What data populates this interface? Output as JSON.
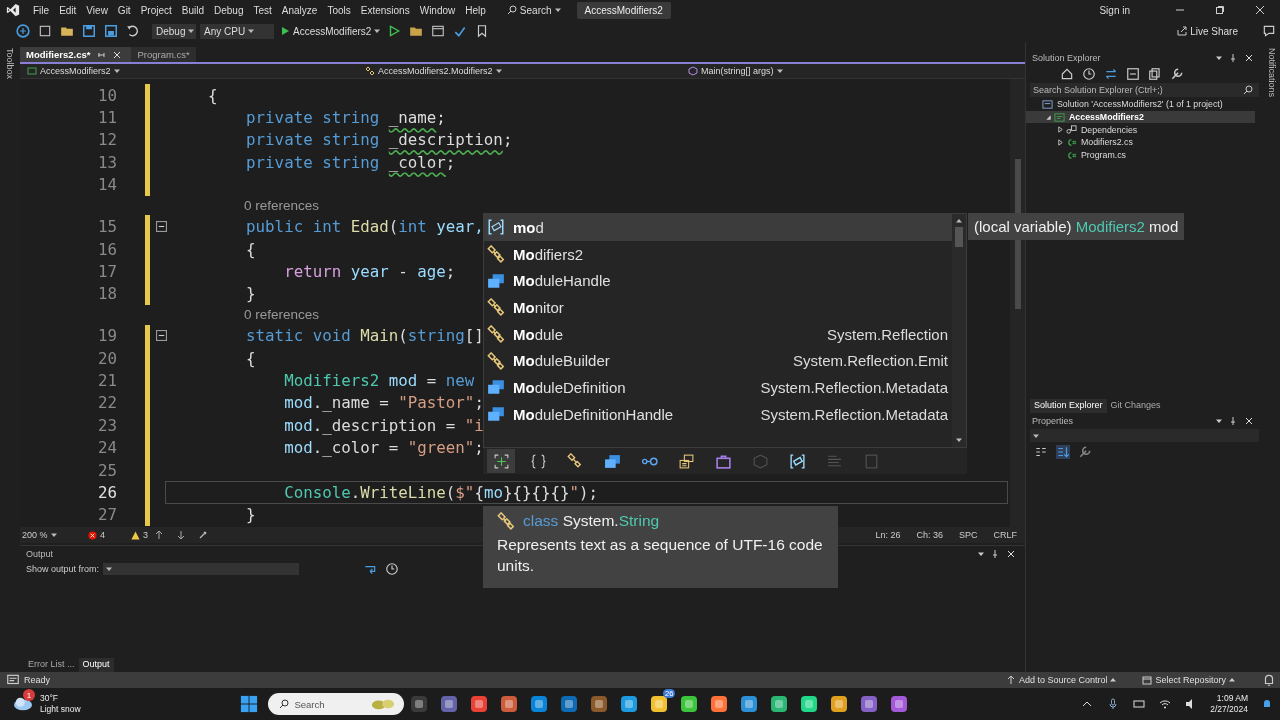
{
  "menu": [
    "File",
    "Edit",
    "View",
    "Git",
    "Project",
    "Build",
    "Debug",
    "Test",
    "Analyze",
    "Tools",
    "Extensions",
    "Window",
    "Help"
  ],
  "search": "Search",
  "solution_title": "AccessModifiers2",
  "sign_in": "Sign in",
  "toolbar": {
    "configuration": "Debug",
    "platform": "Any CPU",
    "run": "AccessModifiers2",
    "live_share": "Live Share"
  },
  "toolbox_label": "Toolbox",
  "notifications_label": "Notifications",
  "editor": {
    "tabs": [
      {
        "label": "Modifiers2.cs*",
        "selected": true
      },
      {
        "label": "Program.cs*",
        "selected": false
      }
    ],
    "nav": [
      "AccessModifiers2",
      "AccessModifiers2.Modifiers2",
      "Main(string[] args)"
    ],
    "lines": [
      {
        "kind": "code",
        "number": "10",
        "fold": false,
        "selected": false,
        "tokens": [
          {
            "t": "    {",
            "kind": "plain"
          }
        ]
      },
      {
        "kind": "code",
        "number": "11",
        "fold": false,
        "selected": false,
        "tokens": [
          {
            "t": "        private string ",
            "kind": "kw"
          },
          {
            "t": "_name",
            "kind": "warn"
          },
          {
            "t": ";",
            "kind": "plain"
          }
        ]
      },
      {
        "kind": "code",
        "number": "12",
        "fold": false,
        "selected": false,
        "tokens": [
          {
            "t": "        private string ",
            "kind": "kw"
          },
          {
            "t": "_description",
            "kind": "warn"
          },
          {
            "t": ";",
            "kind": "plain"
          }
        ]
      },
      {
        "kind": "code",
        "number": "13",
        "fold": false,
        "selected": false,
        "tokens": [
          {
            "t": "        private string ",
            "kind": "kw"
          },
          {
            "t": "_color",
            "kind": "warn"
          },
          {
            "t": ";",
            "kind": "plain"
          }
        ]
      },
      {
        "kind": "code",
        "number": "14",
        "fold": false,
        "selected": false
      },
      {
        "kind": "lens",
        "text": "0 references"
      },
      {
        "kind": "code",
        "number": "15",
        "fold": true,
        "selected": false,
        "tokens": [
          {
            "t": "        public int ",
            "kind": "kw"
          },
          {
            "t": "Edad",
            "kind": "method"
          },
          {
            "t": "(",
            "kind": "plain"
          },
          {
            "t": "int ",
            "kind": "kw"
          },
          {
            "t": "year,",
            "kind": "local"
          }
        ]
      },
      {
        "kind": "code",
        "number": "16",
        "fold": false,
        "selected": false,
        "tokens": [
          {
            "t": "        {",
            "kind": "plain"
          }
        ]
      },
      {
        "kind": "code",
        "number": "17",
        "fold": false,
        "selected": false,
        "tokens": [
          {
            "t": "            return ",
            "kind": "ctrl"
          },
          {
            "t": "year",
            "kind": "local"
          },
          {
            "t": " - ",
            "kind": "plain"
          },
          {
            "t": "age",
            "kind": "local"
          },
          {
            "t": ";",
            "kind": "plain"
          }
        ]
      },
      {
        "kind": "code",
        "number": "18",
        "fold": false,
        "selected": false,
        "tokens": [
          {
            "t": "        }",
            "kind": "plain"
          }
        ]
      },
      {
        "kind": "lens",
        "text": "0 references"
      },
      {
        "kind": "code",
        "number": "19",
        "fold": true,
        "selected": false,
        "tokens": [
          {
            "t": "        static void ",
            "kind": "kw"
          },
          {
            "t": "Main",
            "kind": "method"
          },
          {
            "t": "(",
            "kind": "plain"
          },
          {
            "t": "string",
            "kind": "kw"
          },
          {
            "t": "[]",
            "kind": "plain"
          }
        ]
      },
      {
        "kind": "code",
        "number": "20",
        "fold": false,
        "selected": false,
        "tokens": [
          {
            "t": "        {",
            "kind": "plain"
          }
        ]
      },
      {
        "kind": "code",
        "number": "21",
        "fold": false,
        "selected": false,
        "tokens": [
          {
            "t": "            Modifiers2",
            "kind": "type"
          },
          {
            "t": " mod",
            "kind": "local"
          },
          {
            "t": " = ",
            "kind": "plain"
          },
          {
            "t": "new",
            "kind": "kw"
          }
        ]
      },
      {
        "kind": "code",
        "number": "22",
        "fold": false,
        "selected": false,
        "tokens": [
          {
            "t": "            mod",
            "kind": "local"
          },
          {
            "t": "._name = ",
            "kind": "plain"
          },
          {
            "t": "\"Pastor\"",
            "kind": "str"
          },
          {
            "t": ";",
            "kind": "plain"
          }
        ]
      },
      {
        "kind": "code",
        "number": "23",
        "fold": false,
        "selected": false,
        "tokens": [
          {
            "t": "            mod",
            "kind": "local"
          },
          {
            "t": "._description = ",
            "kind": "plain"
          },
          {
            "t": "\"i",
            "kind": "str"
          }
        ]
      },
      {
        "kind": "code",
        "number": "24",
        "fold": false,
        "selected": false,
        "tokens": [
          {
            "t": "            mod",
            "kind": "local"
          },
          {
            "t": "._color = ",
            "kind": "plain"
          },
          {
            "t": "\"green\"",
            "kind": "str"
          },
          {
            "t": ";",
            "kind": "plain"
          }
        ]
      },
      {
        "kind": "code",
        "number": "25",
        "fold": false,
        "selected": false
      },
      {
        "kind": "code",
        "number": "26",
        "fold": false,
        "selected": true,
        "tokens": [
          {
            "t": "            Console",
            "kind": "type"
          },
          {
            "t": ".",
            "kind": "plain"
          },
          {
            "t": "WriteLine",
            "kind": "method"
          },
          {
            "t": "(",
            "kind": "plain"
          },
          {
            "t": "$\"",
            "kind": "str"
          },
          {
            "t": "{",
            "kind": "plain"
          },
          {
            "t": "mo",
            "kind": "local"
          },
          {
            "t": "}{}{}{}",
            "kind": "plain"
          },
          {
            "t": "\"",
            "kind": "str"
          },
          {
            "t": ");",
            "kind": "plain"
          }
        ]
      },
      {
        "kind": "code",
        "number": "27",
        "fold": false,
        "selected": false,
        "tokens": [
          {
            "t": "        }",
            "kind": "plain"
          }
        ]
      }
    ],
    "status": {
      "zoom": "200 %",
      "errors": "4",
      "warnings": "3",
      "line": "Ln: 26",
      "column": "Ch: 36",
      "whitespace": "SPC",
      "line_ending": "CRLF"
    }
  },
  "completion": {
    "items": [
      {
        "kind": "local",
        "label": "**mo**d",
        "selected": true
      },
      {
        "kind": "class",
        "label": "**Mo**difiers2",
        "selected": false
      },
      {
        "kind": "struct",
        "label": "**Mo**duleHandle",
        "selected": false
      },
      {
        "kind": "class",
        "label": "**Mo**nitor",
        "selected": false
      },
      {
        "kind": "class",
        "label": "**Mo**dule",
        "namespace": "System.Reflection",
        "selected": false
      },
      {
        "kind": "class",
        "label": "**Mo**duleBuilder",
        "namespace": "System.Reflection.Emit",
        "selected": false
      },
      {
        "kind": "struct",
        "label": "**Mo**duleDefinition",
        "namespace": "System.Reflection.Metadata",
        "selected": false
      },
      {
        "kind": "struct",
        "label": "**Mo**duleDefinitionHandle",
        "namespace": "System.Reflection.Metadata",
        "selected": false
      }
    ],
    "filters": [
      {
        "kind": "snippet",
        "selected": true
      },
      {
        "kind": "namespace",
        "selected": false
      },
      {
        "kind": "class",
        "selected": false
      },
      {
        "kind": "struct",
        "selected": false
      },
      {
        "kind": "interface",
        "selected": false
      },
      {
        "kind": "enum",
        "selected": false
      },
      {
        "kind": "delegate",
        "selected": false
      },
      {
        "kind": "module",
        "selected": false
      },
      {
        "kind": "local",
        "selected": false
      },
      {
        "kind": "keyword",
        "selected": false
      },
      {
        "kind": "field",
        "selected": false
      }
    ]
  },
  "quick_info": [
    {
      "t": "(local variable) ",
      "kind": "plain"
    },
    {
      "t": "Modifiers2",
      "kind": "type"
    },
    {
      "t": " mod",
      "kind": "plain"
    }
  ],
  "doc_tooltip": {
    "signature": [
      {
        "t": "class",
        "kind": "kw"
      },
      {
        "t": " System.",
        "kind": "plain"
      },
      {
        "t": "String",
        "kind": "type"
      }
    ],
    "description": "Represents text as a sequence of UTF-16 code units."
  },
  "output": {
    "title": "Output",
    "show_from": "Show output from:",
    "tabs": [
      {
        "label": "Error List ...",
        "selected": false
      },
      {
        "label": "Output",
        "selected": true
      }
    ]
  },
  "solution_explorer": {
    "title": "Solution Explorer",
    "search_placeholder": "Search Solution Explorer (Ctrl+;)",
    "tree": [
      {
        "kind": "solution",
        "label": "Solution 'AccessModifiers2' (1 of 1 project)",
        "selected": false,
        "children": [
          {
            "kind": "project",
            "label": "AccessModifiers2",
            "expanded": true,
            "selected": true,
            "children": [
              {
                "kind": "deps",
                "label": "Dependencies",
                "expanded": false,
                "selected": false
              },
              {
                "kind": "file",
                "label": "Modifiers2.cs",
                "expanded": false,
                "selected": false
              },
              {
                "kind": "file",
                "label": "Program.cs",
                "selected": false
              }
            ]
          }
        ]
      }
    ],
    "tabs": [
      {
        "label": "Solution Explorer",
        "selected": true
      },
      {
        "label": "Git Changes",
        "selected": false
      }
    ]
  },
  "properties": {
    "title": "Properties"
  },
  "status_bar": {
    "text": "Ready",
    "source_control": "Add to Source Control",
    "repository": "Select Repository"
  },
  "taskbar": {
    "temperature": "30°F",
    "weather": "Light snow",
    "weather_badge": "1",
    "search": "Search",
    "mail_badge": "26",
    "time": "1:09 AM",
    "date": "2/27/2024"
  }
}
